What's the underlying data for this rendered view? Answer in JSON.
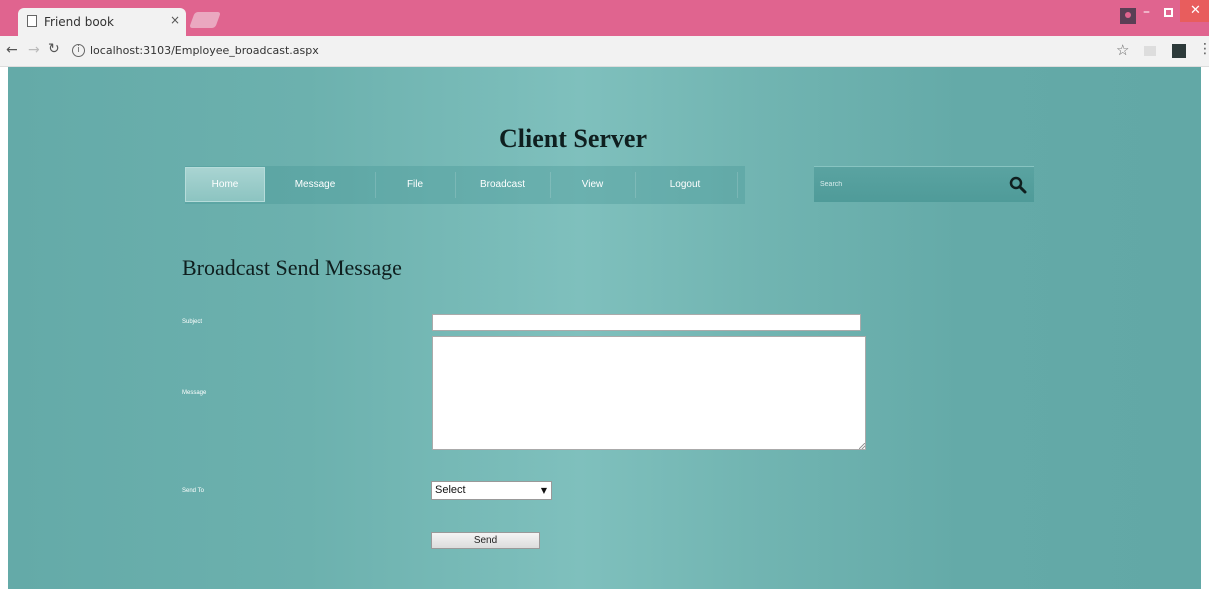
{
  "browser": {
    "tab_title": "Friend book",
    "tab_close": "×",
    "url": "localhost:3103/Employee_broadcast.aspx",
    "info_glyph": "i"
  },
  "site": {
    "title": "Client Server",
    "menu": [
      {
        "label": "Home",
        "active": true
      },
      {
        "label": "Message"
      },
      {
        "label": "File"
      },
      {
        "label": "Broadcast"
      },
      {
        "label": "View"
      },
      {
        "label": "Logout"
      }
    ],
    "search_placeholder": "Search"
  },
  "form": {
    "heading": "Broadcast Send Message",
    "subject_label": "Subject",
    "subject_value": "",
    "message_label": "Message",
    "message_value": "",
    "send_to_label": "Send To",
    "send_to_selected": "Select",
    "send_button": "Send"
  },
  "colors": {
    "titlebar": "#e0648f",
    "page_background": "#6cb1ae",
    "heading_text": "#0f1f1f"
  }
}
